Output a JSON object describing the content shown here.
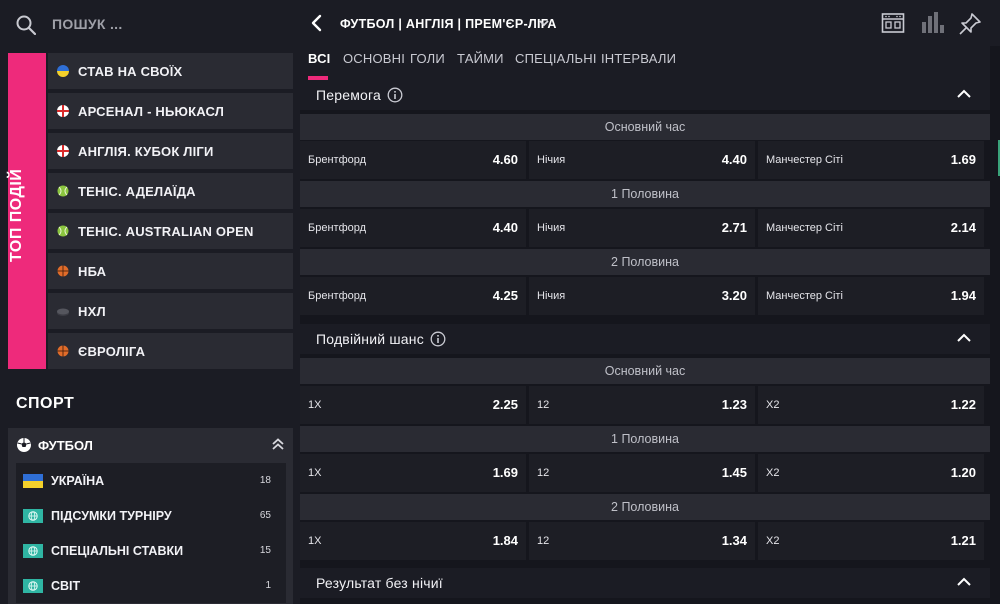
{
  "search": {
    "placeholder": "ПОШУК ..."
  },
  "top": {
    "label": "ТОП ПОДІЙ",
    "items": [
      {
        "label": "СТАВ НА СВОЇХ",
        "icon": "ukraine-flag-icon"
      },
      {
        "label": "АРСЕНАЛ - НЬЮКАСЛ",
        "icon": "england-flag-icon"
      },
      {
        "label": "АНГЛІЯ. КУБОК ЛІГИ",
        "icon": "england-flag-icon"
      },
      {
        "label": "ТЕНІС. АДЕЛАЇДА",
        "icon": "tennis-ball-icon"
      },
      {
        "label": "ТЕНІС. AUSTRALIAN OPEN",
        "icon": "tennis-ball-icon"
      },
      {
        "label": "НБА",
        "icon": "basketball-icon"
      },
      {
        "label": "НХЛ",
        "icon": "hockey-puck-icon"
      },
      {
        "label": "ЄВРОЛІГА",
        "icon": "basketball-icon"
      }
    ]
  },
  "sport": {
    "title": "СПОРТ",
    "current": {
      "label": "ФУТБОЛ",
      "icon": "soccer-ball-icon"
    },
    "items": [
      {
        "label": "УКРАЇНА",
        "count": "18",
        "icon": "ukraine-flag-icon"
      },
      {
        "label": "ПІДСУМКИ ТУРНІРУ",
        "count": "65",
        "icon": "globe-icon"
      },
      {
        "label": "СПЕЦІАЛЬНІ СТАВКИ",
        "count": "15",
        "icon": "globe-icon"
      },
      {
        "label": "СВІТ",
        "count": "1",
        "icon": "globe-icon"
      }
    ]
  },
  "header": {
    "title": "ФУТБОЛ | АНГЛІЯ | ПРЕМ'ЄР-ЛІГА"
  },
  "tabs": [
    {
      "label": "ВСІ",
      "active": true
    },
    {
      "label": "ОСНОВНІ"
    },
    {
      "label": "ГОЛИ"
    },
    {
      "label": "ТАЙМИ"
    },
    {
      "label": "СПЕЦІАЛЬНІ"
    },
    {
      "label": "ІНТЕРВАЛИ"
    }
  ],
  "markets": [
    {
      "title": "Перемога",
      "periods": [
        {
          "label": "Основний час",
          "odds": [
            {
              "name": "Брентфорд",
              "value": "4.60"
            },
            {
              "name": "Нічия",
              "value": "4.40"
            },
            {
              "name": "Манчестер Сіті",
              "value": "1.69"
            }
          ]
        },
        {
          "label": "1 Половина",
          "odds": [
            {
              "name": "Брентфорд",
              "value": "4.40"
            },
            {
              "name": "Нічия",
              "value": "2.71"
            },
            {
              "name": "Манчестер Сіті",
              "value": "2.14"
            }
          ]
        },
        {
          "label": "2 Половина",
          "odds": [
            {
              "name": "Брентфорд",
              "value": "4.25"
            },
            {
              "name": "Нічия",
              "value": "3.20"
            },
            {
              "name": "Манчестер Сіті",
              "value": "1.94"
            }
          ]
        }
      ]
    },
    {
      "title": "Подвійний шанс",
      "periods": [
        {
          "label": "Основний час",
          "odds": [
            {
              "name": "1X",
              "value": "2.25"
            },
            {
              "name": "12",
              "value": "1.23"
            },
            {
              "name": "X2",
              "value": "1.22"
            }
          ]
        },
        {
          "label": "1 Половина",
          "odds": [
            {
              "name": "1X",
              "value": "1.69"
            },
            {
              "name": "12",
              "value": "1.45"
            },
            {
              "name": "X2",
              "value": "1.20"
            }
          ]
        },
        {
          "label": "2 Половина",
          "odds": [
            {
              "name": "1X",
              "value": "1.84"
            },
            {
              "name": "12",
              "value": "1.34"
            },
            {
              "name": "X2",
              "value": "1.21"
            }
          ]
        }
      ]
    },
    {
      "title": "Результат без нічиї"
    }
  ],
  "colors": {
    "accent": "#ee2a7b",
    "bg": "#15161d",
    "panel": "#2a2b33"
  }
}
